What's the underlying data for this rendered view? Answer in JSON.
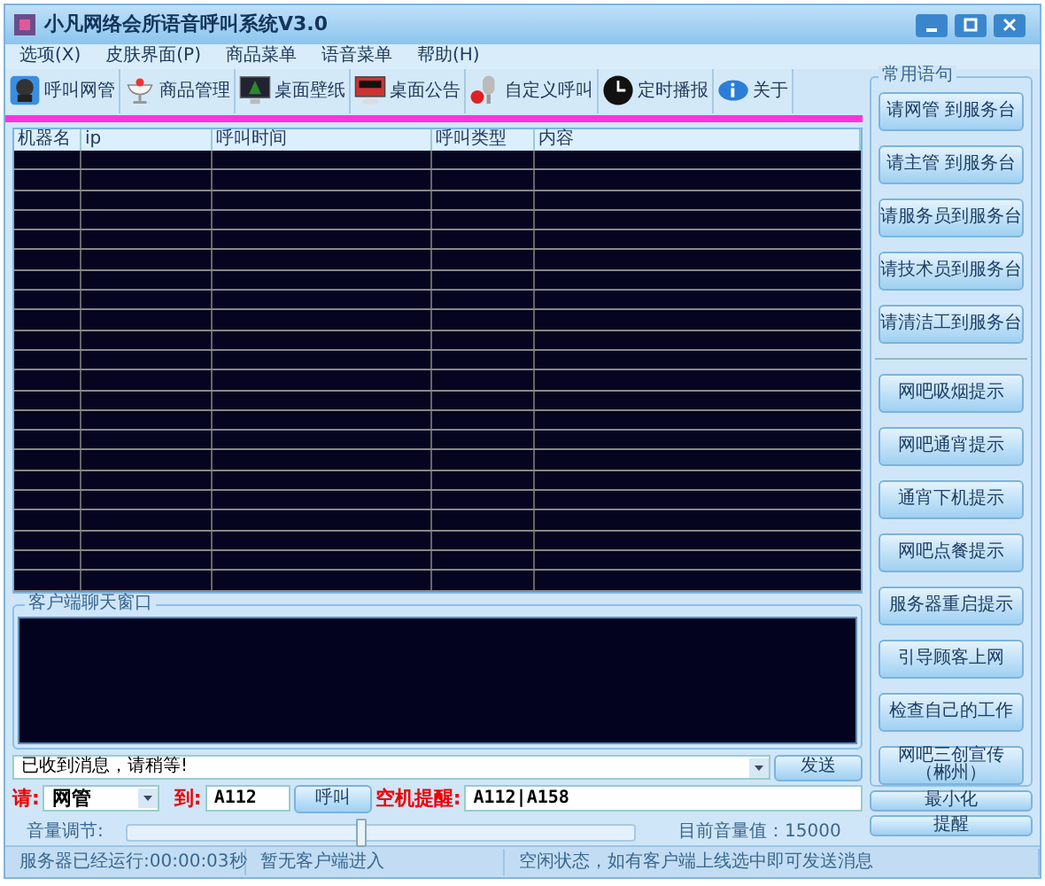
{
  "window": {
    "title": "小凡网络会所语音呼叫系统V3.0"
  },
  "menu": [
    "选项(X)",
    "皮肤界面(P)",
    "商品菜单",
    "语音菜单",
    "帮助(H)"
  ],
  "toolbar": [
    {
      "label": "呼叫网管",
      "kind": "headset"
    },
    {
      "label": "商品管理",
      "kind": "cup"
    },
    {
      "label": "桌面壁纸",
      "kind": "monitor"
    },
    {
      "label": "桌面公告",
      "kind": "screen"
    },
    {
      "label": "自定义呼叫",
      "kind": "mic"
    },
    {
      "label": "定时播报",
      "kind": "clock"
    },
    {
      "label": "关于",
      "kind": "info"
    }
  ],
  "table": {
    "columns": [
      "机器名",
      "ip",
      "呼叫时间",
      "呼叫类型",
      "内容"
    ]
  },
  "chat": {
    "title": "客户端聊天窗口"
  },
  "message": {
    "value": "已收到消息，请稍等!",
    "send": "发送",
    "minimize": "最小化"
  },
  "call": {
    "please_label": "请:",
    "role": "网管",
    "to_label": "到:",
    "seat": "A112",
    "call_button": "呼叫",
    "idle_label": "空机提醒:",
    "idle_value": "A112|A158",
    "remind_button": "提醒"
  },
  "volume": {
    "label": "音量调节:",
    "level": 0.46,
    "reading": "目前音量值：15000"
  },
  "status_bar": [
    "服务器已经运行:00:00:03秒",
    "暂无客户端进入",
    "空闲状态，如有客户端上线选中即可发送消息"
  ],
  "phrases": {
    "title": "常用语句",
    "groups": [
      [
        "请网管 到服务台",
        "请主管 到服务台",
        "请服务员到服务台",
        "请技术员到服务台",
        "请清洁工到服务台"
      ],
      [
        "网吧吸烟提示",
        "网吧通宵提示",
        "通宵下机提示",
        "网吧点餐提示",
        "服务器重启提示",
        "引导顾客上网",
        "检查自己的工作",
        "网吧三创宣传（郴州）"
      ]
    ]
  }
}
